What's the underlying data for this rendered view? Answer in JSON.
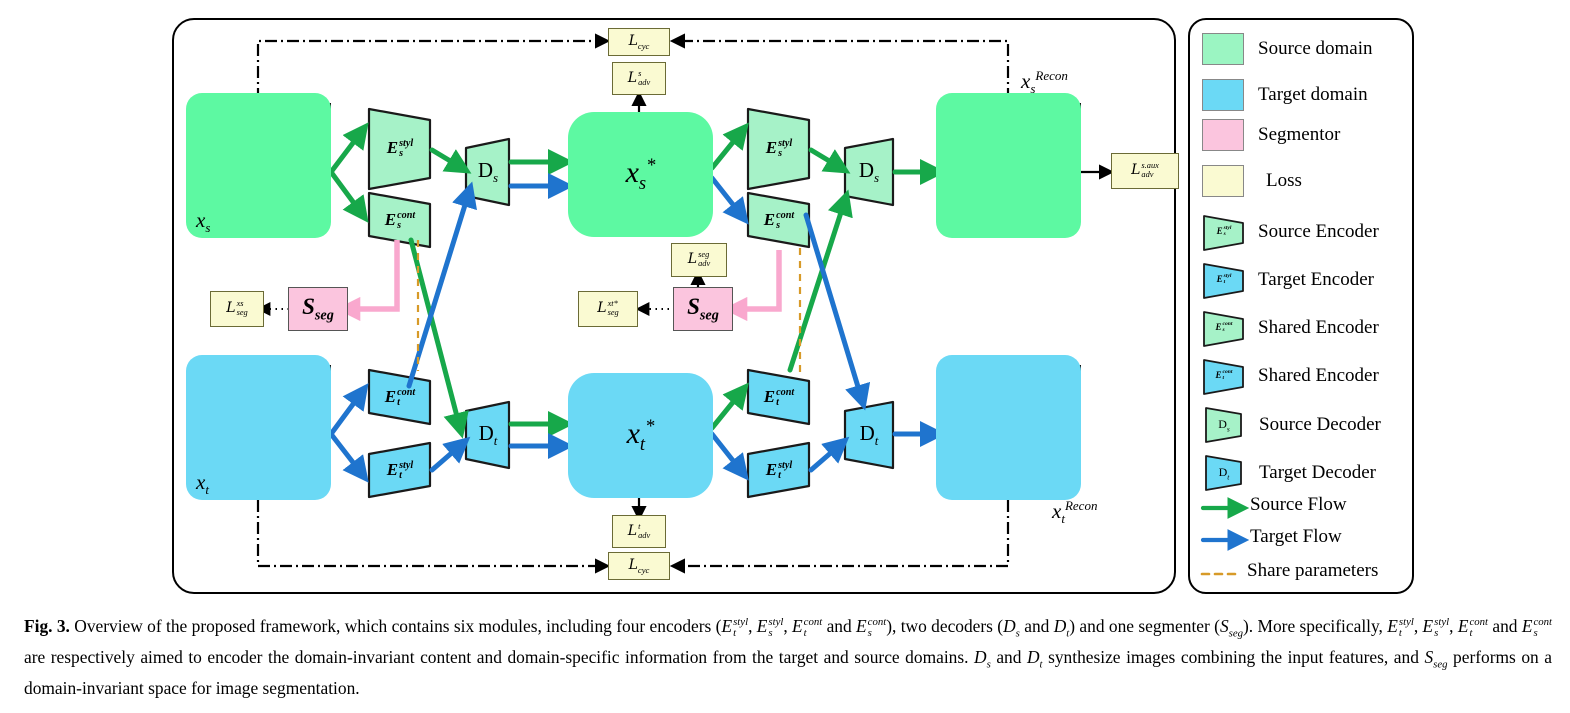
{
  "figure": {
    "label": "Fig. 3.",
    "caption_part1": "Overview of the proposed framework, which contains six modules, including four encoders (",
    "caption_part2": "), two decoders (",
    "caption_part3": ") and one segmenter (",
    "caption_part4": "). More specifically, ",
    "caption_part5": " are respectively aimed to encoder the domain-invariant content and domain-specific information from the target and source domains. ",
    "caption_part6": " synthesize images combining the input features, and ",
    "caption_part7": " performs on a domain-invariant space for image segmentation.",
    "cap_and": " and ",
    "cap_comma": ", ",
    "cap_Ds": "Ds",
    "cap_Dt": "Dt",
    "cap_Sseg": "Sseg",
    "cap_DsDt": "Ds and Dt"
  },
  "colors": {
    "source_domain": "#5DF9A2",
    "target_domain": "#6BD9F5",
    "source_encoder": "#A6F2C8",
    "target_encoder": "#6BD9F5",
    "segmentor": "#FBC5DE",
    "loss": "#FAFAD2",
    "source_flow": "#17A84A",
    "target_flow": "#1F74CE",
    "share_params": "#D79A28",
    "cycle_line": "#000000"
  },
  "diagram": {
    "inputs": [
      {
        "name": "source-input",
        "label_base": "x",
        "label_sub": "s",
        "label_sup": "",
        "domain": "source"
      },
      {
        "name": "target-input",
        "label_base": "x",
        "label_sub": "t",
        "label_sup": "",
        "domain": "target"
      }
    ],
    "outputs": [
      {
        "name": "source-recon",
        "label_base": "x",
        "label_sub": "s",
        "label_sup": "Recon",
        "domain": "source"
      },
      {
        "name": "target-recon",
        "label_base": "x",
        "label_sub": "t",
        "label_sup": "Recon",
        "domain": "target"
      }
    ],
    "feature_blocks": [
      {
        "name": "source-synth-block",
        "label_base": "x",
        "label_sub": "s",
        "label_sup": "*",
        "domain": "source"
      },
      {
        "name": "target-synth-block",
        "label_base": "x",
        "label_sub": "t",
        "label_sup": "*",
        "domain": "target"
      }
    ],
    "encoders": [
      {
        "name": "encoder-s-styl-left",
        "base": "E",
        "sub": "s",
        "sup": "styl",
        "domain": "source"
      },
      {
        "name": "encoder-s-cont-left",
        "base": "E",
        "sub": "s",
        "sup": "cont",
        "domain": "source"
      },
      {
        "name": "encoder-t-cont-left",
        "base": "E",
        "sub": "t",
        "sup": "cont",
        "domain": "target"
      },
      {
        "name": "encoder-t-styl-left",
        "base": "E",
        "sub": "t",
        "sup": "styl",
        "domain": "target"
      },
      {
        "name": "encoder-s-styl-right",
        "base": "E",
        "sub": "s",
        "sup": "styl",
        "domain": "source"
      },
      {
        "name": "encoder-s-cont-right",
        "base": "E",
        "sub": "s",
        "sup": "cont",
        "domain": "source"
      },
      {
        "name": "encoder-t-cont-right",
        "base": "E",
        "sub": "t",
        "sup": "cont",
        "domain": "target"
      },
      {
        "name": "encoder-t-styl-right",
        "base": "E",
        "sub": "t",
        "sup": "styl",
        "domain": "target"
      }
    ],
    "decoders": [
      {
        "name": "decoder-ds-left",
        "base": "D",
        "sub": "s",
        "domain": "source"
      },
      {
        "name": "decoder-dt-left",
        "base": "D",
        "sub": "t",
        "domain": "target"
      },
      {
        "name": "decoder-ds-right",
        "base": "D",
        "sub": "s",
        "domain": "source"
      },
      {
        "name": "decoder-dt-right",
        "base": "D",
        "sub": "t",
        "domain": "target"
      }
    ],
    "segmentors": [
      {
        "name": "segmentor-left",
        "base": "S",
        "sub": "seg"
      },
      {
        "name": "segmentor-center",
        "base": "S",
        "sub": "seg"
      }
    ],
    "losses": [
      {
        "name": "loss-cyc-top",
        "base": "L",
        "sub": "cyc",
        "sup": ""
      },
      {
        "name": "loss-adv-s",
        "base": "L",
        "sub": "adv",
        "sup": "s"
      },
      {
        "name": "loss-adv-s-aux",
        "base": "L",
        "sub": "adv",
        "sup": "s.aux"
      },
      {
        "name": "loss-adv-seg",
        "base": "L",
        "sub": "adv",
        "sup": "seg"
      },
      {
        "name": "loss-seg-xs",
        "base": "L",
        "sub": "seg",
        "sup": "xs"
      },
      {
        "name": "loss-seg-xt-star",
        "base": "L",
        "sub": "seg",
        "sup": "xt*"
      },
      {
        "name": "loss-adv-t",
        "base": "L",
        "sub": "adv",
        "sup": "t"
      },
      {
        "name": "loss-cyc-bottom",
        "base": "L",
        "sub": "cyc",
        "sup": ""
      }
    ]
  },
  "legend": {
    "items": [
      {
        "name": "legend-source-domain",
        "icon": "swatch-green",
        "label": "Source domain"
      },
      {
        "name": "legend-target-domain",
        "icon": "swatch-blue",
        "label": "Target domain"
      },
      {
        "name": "legend-segmentor",
        "icon": "swatch-pink",
        "label": "Segmentor"
      },
      {
        "name": "legend-loss",
        "icon": "swatch-yellow",
        "label": "Loss"
      },
      {
        "name": "legend-source-encoder",
        "icon": "trapezoid-green",
        "label": "Source Encoder",
        "sym_base": "E",
        "sym_sub": "s",
        "sym_sup": "styl"
      },
      {
        "name": "legend-target-encoder",
        "icon": "trapezoid-blue",
        "label": "Target Encoder",
        "sym_base": "E",
        "sym_sub": "t",
        "sym_sup": "styl"
      },
      {
        "name": "legend-shared-encoder-s",
        "icon": "trapezoid-green",
        "label": "Shared Encoder",
        "sym_base": "E",
        "sym_sub": "s",
        "sym_sup": "cont"
      },
      {
        "name": "legend-shared-encoder-t",
        "icon": "trapezoid-blue",
        "label": "Shared Encoder",
        "sym_base": "E",
        "sym_sub": "t",
        "sym_sup": "cont"
      },
      {
        "name": "legend-source-decoder",
        "icon": "trapezoid-green",
        "label": "Source Decoder",
        "sym_base": "D",
        "sym_sub": "s",
        "sym_sup": ""
      },
      {
        "name": "legend-target-decoder",
        "icon": "trapezoid-blue",
        "label": "Target Decoder",
        "sym_base": "D",
        "sym_sub": "t",
        "sym_sup": ""
      },
      {
        "name": "legend-source-flow",
        "icon": "arrow-green",
        "label": "Source Flow"
      },
      {
        "name": "legend-target-flow",
        "icon": "arrow-blue",
        "label": "Target Flow"
      },
      {
        "name": "legend-share-params",
        "icon": "dashed-line-orange",
        "label": "Share parameters"
      }
    ]
  }
}
